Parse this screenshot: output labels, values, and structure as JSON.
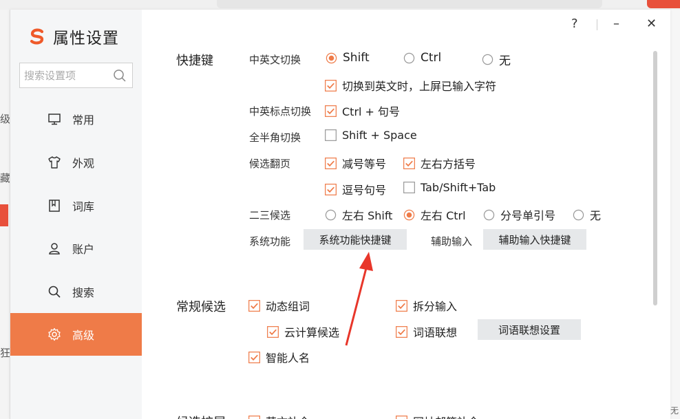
{
  "colors": {
    "accent": "#ef7b48",
    "arrow": "#e8362a"
  },
  "background": {
    "side_chars": [
      "级",
      "藏",
      "狂"
    ],
    "right_chars": [
      "无"
    ]
  },
  "window": {
    "title": "属性设置",
    "controls": {
      "help": "?",
      "minimize": "–",
      "close": "✕"
    }
  },
  "sidebar": {
    "search_placeholder": "搜索设置项",
    "items": [
      {
        "label": "常用",
        "icon": "monitor-icon",
        "active": false
      },
      {
        "label": "外观",
        "icon": "shirt-icon",
        "active": false
      },
      {
        "label": "词库",
        "icon": "dictionary-icon",
        "active": false
      },
      {
        "label": "账户",
        "icon": "user-icon",
        "active": false
      },
      {
        "label": "搜索",
        "icon": "search-icon",
        "active": false
      },
      {
        "label": "高级",
        "icon": "gear-icon",
        "active": true
      }
    ]
  },
  "shortcuts": {
    "title": "快捷键",
    "cn_en_switch": {
      "label": "中英文切换",
      "options": [
        {
          "label": "Shift",
          "selected": true
        },
        {
          "label": "Ctrl",
          "selected": false
        },
        {
          "label": "无",
          "selected": false
        }
      ],
      "commit_on_switch": {
        "label": "切换到英文时，上屏已输入字符",
        "checked": true
      }
    },
    "punct_switch": {
      "label": "中英标点切换",
      "option": {
        "label": "Ctrl + 句号",
        "checked": true
      }
    },
    "width_switch": {
      "label": "全半角切换",
      "option": {
        "label": "Shift + Space",
        "checked": false
      }
    },
    "page_turn": {
      "label": "候选翻页",
      "options": [
        {
          "label": "减号等号",
          "checked": true
        },
        {
          "label": "左右方括号",
          "checked": true
        },
        {
          "label": "逗号句号",
          "checked": true
        },
        {
          "label": "Tab/Shift+Tab",
          "checked": false
        }
      ]
    },
    "second_third": {
      "label": "二三候选",
      "options": [
        {
          "label": "左右 Shift",
          "selected": false
        },
        {
          "label": "左右 Ctrl",
          "selected": true
        },
        {
          "label": "分号单引号",
          "selected": false
        },
        {
          "label": "无",
          "selected": false
        }
      ]
    },
    "system": {
      "label": "系统功能",
      "button": "系统功能快捷键"
    },
    "assist": {
      "label": "辅助输入",
      "button": "辅助输入快捷键"
    }
  },
  "candidates": {
    "title": "常规候选",
    "dynamic_words": {
      "label": "动态组词",
      "checked": true
    },
    "cloud": {
      "label": "云计算候选",
      "checked": true
    },
    "smart_names": {
      "label": "智能人名",
      "checked": true
    },
    "split_input": {
      "label": "拆分输入",
      "checked": true
    },
    "word_assoc": {
      "label": "词语联想",
      "checked": true
    },
    "word_assoc_button": "词语联想设置"
  },
  "extension": {
    "title": "候选扩展",
    "english_completion": {
      "label": "英文补全",
      "checked": true
    },
    "email_completion": {
      "label": "网址邮箱补全",
      "checked": true
    }
  }
}
